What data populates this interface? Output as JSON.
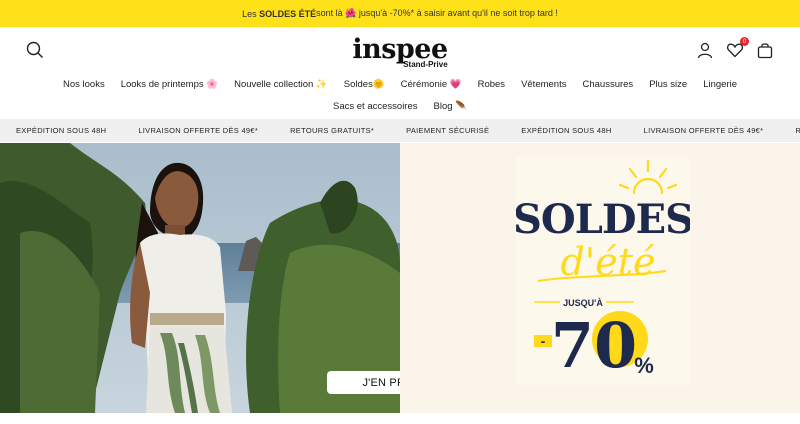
{
  "promo": {
    "pre": "Les ",
    "bold": "SOLDES ÉTÉ",
    "post": " sont là 🌺 jusqu'à -70%* à saisir avant qu'il ne soit trop tard !"
  },
  "brand": {
    "name": "inspee",
    "sub": "Stand-Prive"
  },
  "header": {
    "wishlist_count": "0"
  },
  "nav": [
    "Nos looks",
    "Looks de printemps 🌸",
    "Nouvelle collection ✨",
    "Soldes🌞",
    "Cérémonie 💗",
    "Robes",
    "Vêtements",
    "Chaussures",
    "Plus size",
    "Lingerie",
    "Sacs et accessoires",
    "Blog 🪶"
  ],
  "strip": [
    "EXPÉDITION SOUS 48H",
    "LIVRAISON OFFERTE DÈS 49€*",
    "RETOURS GRATUITS*",
    "PAIEMENT SÉCURISÉ",
    "EXPÉDITION SOUS 48H",
    "LIVRAISON OFFERTE DÈS 49€*",
    "RETOURS GRATUITS*"
  ],
  "hero": {
    "cta": "J'EN PROFITE",
    "poster": {
      "title": "SOLDES",
      "script": "d'été",
      "jusqua": "JUSQU'À",
      "minus": "-",
      "big": "70",
      "pct": "%"
    }
  },
  "colors": {
    "promo_bg": "#ffe11a",
    "poster_navy": "#1d2a4d",
    "poster_yellow": "#ffd91a"
  }
}
